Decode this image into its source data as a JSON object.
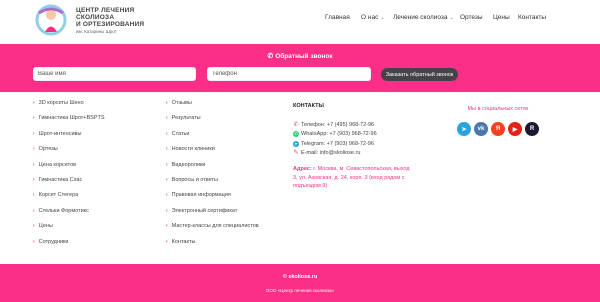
{
  "header": {
    "logo_line1": "ЦЕНТР ЛЕЧЕНИЯ",
    "logo_line2": "СКОЛИОЗА",
    "logo_line3": "И ОРТЕЗИРОВАНИЯ",
    "logo_sub": "им. Катарины Шрот",
    "nav": [
      {
        "label": "Главная"
      },
      {
        "label": "О нас"
      },
      {
        "label": "Лечение сколиоза"
      },
      {
        "label": "Ортезы"
      },
      {
        "label": "Цены"
      },
      {
        "label": "Контакты"
      }
    ]
  },
  "callback": {
    "title": "Обратный звонок",
    "name_placeholder": "Ваше имя",
    "phone_placeholder": "Телефон",
    "button_label": "Заказать обратный звонок"
  },
  "footer": {
    "col1": [
      "3D корсеты Шено",
      "Гимнастика Шрот+BSPTS",
      "Шрот-интенсивы",
      "Ортезы",
      "Цена корсетов",
      "Гимнастика Схас",
      "Корсет Стегера",
      "Стельки Формотикс",
      "Цены",
      "Сотрудники"
    ],
    "col2": [
      "Отзывы",
      "Результаты",
      "Статьи",
      "Новости клиники",
      "Видеоролики",
      "Вопросы и ответы",
      "Правовая информация",
      "Электронный сертификат",
      "Мастер-классы для специалистов",
      "Контакты"
    ],
    "contacts": {
      "title": "КОНТАКТЫ",
      "phone": "Телефон: +7 (495) 968-72-96",
      "whatsapp": "WhatsApp: +7 (903) 968-72-96",
      "telegram": "Telegram: +7 (903) 968-72-96",
      "email": "E-mail: info@skoliose.ru",
      "address_label": "Адрес:",
      "address": "г. Москва, м. Севастопольская, выход 3, ул. Азовская, д. 24, корп. 3 (вход рядом с подъездом 9)"
    },
    "social_title": "Мы в социальных сетях",
    "social": [
      {
        "icon": "telegram-icon",
        "glyph": "➤",
        "color": "#2aa3dc"
      },
      {
        "icon": "vk-icon",
        "glyph": "vk",
        "color": "#4a76a8"
      },
      {
        "icon": "yandex-icon",
        "glyph": "Я",
        "color": "#fc3f1d"
      },
      {
        "icon": "youtube-icon",
        "glyph": "▶",
        "color": "#e62117"
      },
      {
        "icon": "rutube-icon",
        "glyph": "R",
        "color": "#1b1b2f"
      }
    ]
  },
  "bottom": {
    "copyright": "© skoliose.ru",
    "org": "ООО «Центр лечения сколиоза»"
  },
  "colors": {
    "accent": "#fb2f87",
    "button": "#474247"
  }
}
